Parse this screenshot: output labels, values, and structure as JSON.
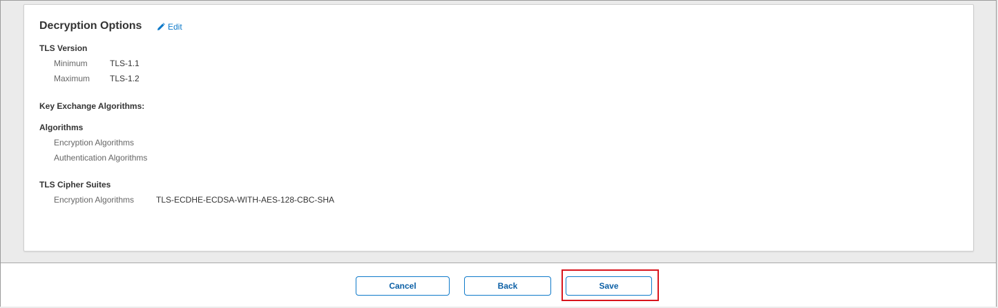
{
  "decryption": {
    "title": "Decryption Options",
    "edit_label": "Edit",
    "tls_version": {
      "label": "TLS Version",
      "minimum_label": "Minimum",
      "minimum_value": "TLS-1.1",
      "maximum_label": "Maximum",
      "maximum_value": "TLS-1.2"
    },
    "key_exchange": {
      "label": "Key Exchange Algorithms:"
    },
    "algorithms": {
      "label": "Algorithms",
      "encryption_label": "Encryption Algorithms",
      "authentication_label": "Authentication Algorithms"
    },
    "cipher_suites": {
      "label": "TLS Cipher Suites",
      "encryption_label": "Encryption Algorithms",
      "encryption_value": "TLS-ECDHE-ECDSA-WITH-AES-128-CBC-SHA"
    }
  },
  "footer": {
    "cancel_label": "Cancel",
    "back_label": "Back",
    "save_label": "Save"
  },
  "colors": {
    "accent": "#0b78c9",
    "highlight": "#d8141c"
  },
  "icons": {
    "edit": "pencil-icon"
  }
}
